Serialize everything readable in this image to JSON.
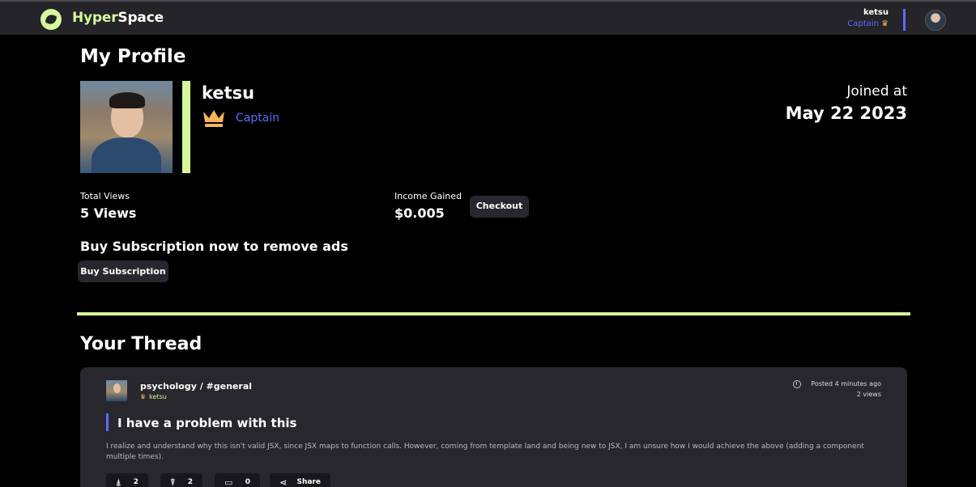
{
  "nav": {
    "brand_part1": "Hyper",
    "brand_part2": "Space",
    "username": "ketsu",
    "role": "Captain"
  },
  "profile": {
    "title": "My Profile",
    "name": "ketsu",
    "role": "Captain",
    "joined_label": "Joined at",
    "joined_date": "May 22 2023"
  },
  "stats": {
    "views_label": "Total Views",
    "views_value": "5 Views",
    "income_label": "Income Gained",
    "income_value": "$0.005",
    "checkout_label": "Checkout"
  },
  "subscription": {
    "heading": "Buy Subscription now to remove ads",
    "button_label": "Buy Subscription"
  },
  "thread": {
    "title": "Your Thread",
    "post": {
      "channel": "psychology / #general",
      "author": "ketsu",
      "posted": "Posted 4 minutes ago",
      "views": "2 views",
      "title": "I have a problem with this",
      "body": "I realize and understand why this isn't valid JSX, since JSX maps to function calls. However, coming from template land and being new to JSX, I am unsure how I would achieve the above (adding a component multiple times).",
      "likes": "2",
      "dislikes": "2",
      "comments": "0",
      "share_label": "Share"
    }
  },
  "colors": {
    "accent_green": "#d6f79a",
    "accent_blue": "#5b6cff",
    "crown": "#f6b55b",
    "card_bg": "#27272d"
  },
  "icons": [
    "logo-icon",
    "crown-icon",
    "clock-icon",
    "like-icon",
    "dislike-icon",
    "comment-icon",
    "share-icon"
  ]
}
